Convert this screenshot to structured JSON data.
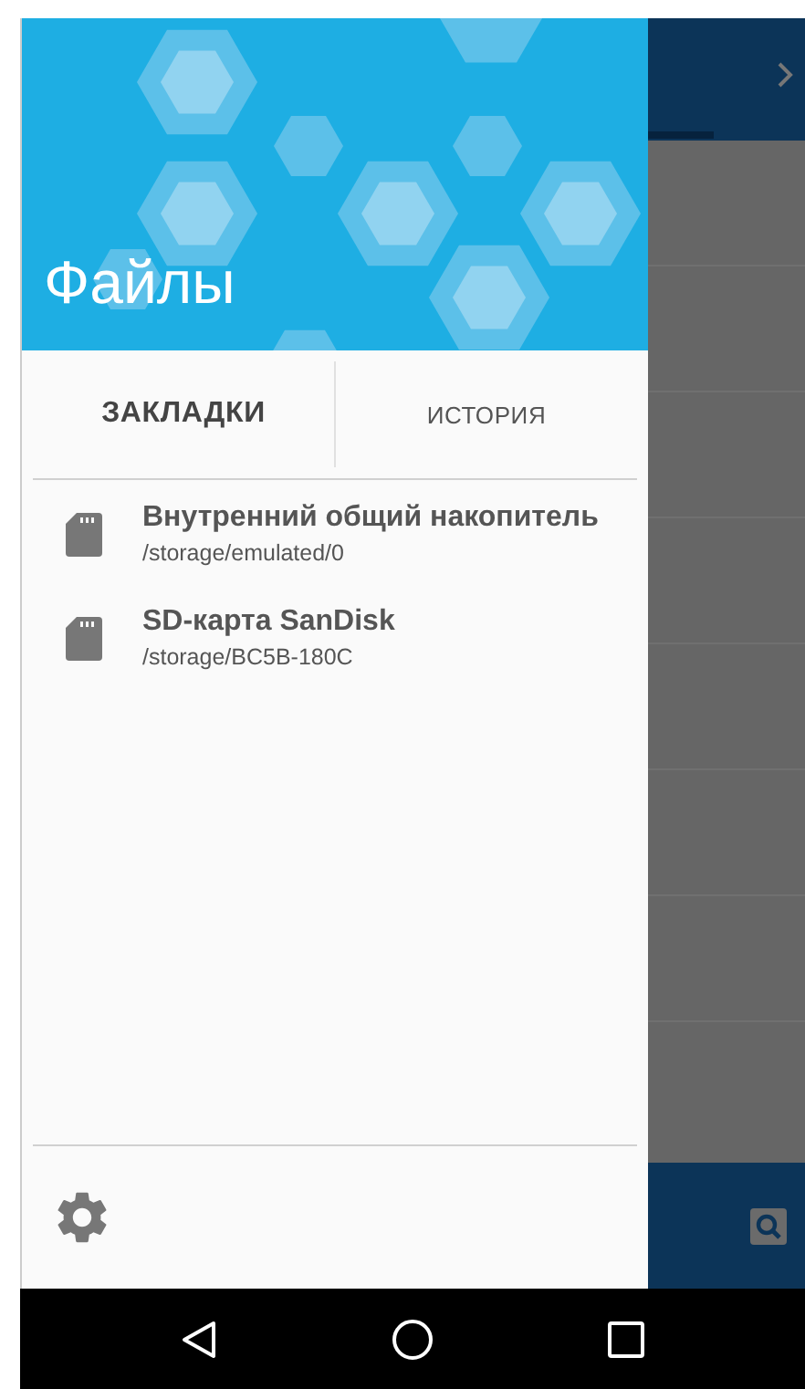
{
  "drawer": {
    "title": "Файлы",
    "tabs": [
      {
        "label": "ЗАКЛАДКИ",
        "selected": true
      },
      {
        "label": "ИСТОРИЯ",
        "selected": false
      }
    ],
    "storage_items": [
      {
        "name": "Внутренний общий накопитель",
        "path": "/storage/emulated/0"
      },
      {
        "name": "SD-карта SanDisk",
        "path": "/storage/BC5B-180C"
      }
    ]
  },
  "nav_bar": {
    "buttons": [
      {
        "kind": "back"
      },
      {
        "kind": "home"
      },
      {
        "kind": "recents"
      }
    ]
  }
}
